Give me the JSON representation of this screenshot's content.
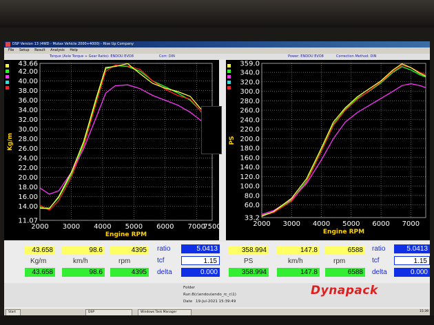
{
  "window": {
    "title": "DSP Version 13 (4WD - Mutax Vehicle 2000+4000) - Rise Up Company",
    "menu": [
      "File",
      "Setup",
      "Result",
      "Analysis",
      "Help"
    ]
  },
  "status": {
    "left": "Torque (Axle Torque ÷ Gear Ratio): ENDOU EVO8",
    "corr_left": "Corr: DIN",
    "right": "Power: ENDOU EVO8",
    "corr_right": "Correction Method: DIN"
  },
  "colors": {
    "green": "#22ff22",
    "red": "#ff2020",
    "magenta": "#ff33ff",
    "yellow": "#ffff44",
    "cyan": "#33dddd",
    "accent": "#ffd200"
  },
  "left_chart": {
    "ylabel": "Kg/m",
    "xlabel": "Engine RPM",
    "y_ticks": [
      "43.66",
      "42.00",
      "40.00",
      "38.00",
      "36.00",
      "34.00",
      "32.00",
      "30.00",
      "28.00",
      "26.00",
      "24.00",
      "22.00",
      "20.00",
      "18.00",
      "16.00",
      "14.00",
      "11.07"
    ],
    "x_ticks": [
      "2000",
      "3000",
      "4000",
      "5000",
      "6000",
      "7000",
      "7500"
    ]
  },
  "right_chart": {
    "ylabel": "PS",
    "xlabel": "Engine RPM",
    "y_ticks": [
      "359.0",
      "340.0",
      "320.0",
      "300.0",
      "280.0",
      "260.0",
      "240.0",
      "220.0",
      "200.0",
      "180.0",
      "160.0",
      "140.0",
      "120.0",
      "100.0",
      "80.0",
      "60.0",
      "33.2"
    ],
    "x_ticks": [
      "2000",
      "3000",
      "4000",
      "5000",
      "6000",
      "7000"
    ]
  },
  "chart_data": [
    {
      "type": "line",
      "xlabel": "Engine RPM",
      "ylabel": "Kg/m",
      "xlim": [
        2000,
        7500
      ],
      "ylim": [
        11.07,
        43.66
      ],
      "grid": true,
      "series": [
        {
          "color": "#22ff22",
          "x": [
            2000,
            2300,
            2600,
            3000,
            3400,
            3800,
            4100,
            4400,
            4800,
            5200,
            5600,
            6000,
            6400,
            6800,
            7100,
            7500
          ],
          "values": [
            13.8,
            13.6,
            15.8,
            20.5,
            27.0,
            36.0,
            42.5,
            43.2,
            43.0,
            42.0,
            40.0,
            38.8,
            37.5,
            36.0,
            34.0,
            30.5
          ]
        },
        {
          "color": "#ff2020",
          "x": [
            2000,
            2300,
            2600,
            3000,
            3400,
            3800,
            4100,
            4400,
            4800,
            5200,
            5600,
            6000,
            6400,
            6800,
            7100,
            7500
          ],
          "values": [
            14.2,
            13.2,
            15.2,
            20.0,
            26.5,
            35.5,
            42.0,
            43.3,
            43.1,
            42.4,
            40.0,
            38.3,
            37.0,
            36.2,
            34.0,
            31.0
          ]
        },
        {
          "color": "#ff33ff",
          "x": [
            2000,
            2300,
            2600,
            3000,
            3400,
            3800,
            4100,
            4400,
            4800,
            5200,
            5600,
            6000,
            6400,
            6800,
            7100,
            7500
          ],
          "values": [
            17.8,
            16.5,
            17.2,
            21.0,
            26.0,
            32.5,
            37.5,
            39.0,
            39.2,
            38.4,
            37.0,
            36.0,
            35.0,
            33.5,
            32.0,
            30.0
          ]
        },
        {
          "color": "#ffff44",
          "x": [
            2000,
            2300,
            2600,
            3000,
            3400,
            3800,
            4100,
            4400,
            4800,
            5200,
            5600,
            6000,
            6400,
            6800,
            7100,
            7500
          ],
          "values": [
            13.6,
            13.5,
            16.0,
            21.0,
            27.5,
            36.5,
            42.8,
            43.0,
            43.6,
            41.5,
            39.5,
            38.5,
            37.8,
            36.8,
            34.5,
            31.5
          ]
        }
      ]
    },
    {
      "type": "line",
      "xlabel": "Engine RPM",
      "ylabel": "PS",
      "xlim": [
        2000,
        7500
      ],
      "ylim": [
        33.2,
        359.0
      ],
      "grid": true,
      "series": [
        {
          "color": "#22ff22",
          "x": [
            2000,
            2400,
            3000,
            3500,
            4000,
            4400,
            4800,
            5200,
            5600,
            6000,
            6400,
            6700,
            7000,
            7300,
            7500
          ],
          "values": [
            38,
            45,
            70,
            110,
            175,
            230,
            262,
            285,
            300,
            318,
            340,
            352,
            345,
            335,
            330
          ]
        },
        {
          "color": "#ff2020",
          "x": [
            2000,
            2400,
            3000,
            3500,
            4000,
            4400,
            4800,
            5200,
            5600,
            6000,
            6400,
            6700,
            7000,
            7300,
            7500
          ],
          "values": [
            37,
            44,
            68,
            108,
            173,
            228,
            260,
            283,
            301,
            320,
            342,
            355,
            350,
            340,
            335
          ]
        },
        {
          "color": "#ff33ff",
          "x": [
            2000,
            2400,
            3000,
            3500,
            4000,
            4400,
            4800,
            5200,
            5600,
            6000,
            6400,
            6700,
            7000,
            7300,
            7500
          ],
          "values": [
            40,
            48,
            72,
            105,
            155,
            200,
            235,
            255,
            270,
            285,
            300,
            312,
            316,
            312,
            308
          ]
        },
        {
          "color": "#ffff44",
          "x": [
            2000,
            2400,
            3000,
            3500,
            4000,
            4400,
            4800,
            5200,
            5600,
            6000,
            6400,
            6700,
            7000,
            7300,
            7500
          ],
          "values": [
            36,
            46,
            74,
            115,
            180,
            235,
            265,
            288,
            305,
            322,
            345,
            358,
            350,
            338,
            332
          ]
        }
      ]
    }
  ],
  "readouts": {
    "torque_top": "43.658",
    "speed_top": "98.6",
    "rpm_top": "4395",
    "torque_unit": "Kg/m",
    "speed_unit": "km/h",
    "rpm_unit": "rpm",
    "torque_bot": "43.658",
    "speed_bot": "98.6",
    "rpm_bot": "4395",
    "ratio_label": "ratio",
    "ratio_left": "5.0413",
    "tcf_label": "tcf",
    "tcf_left": "1.15",
    "delta_label": "delta",
    "delta_left": "0.000",
    "power_top": "358.994",
    "pspeed_top": "147.8",
    "prpm_top": "6588",
    "power_unit": "PS",
    "pspeed_unit": "km/h",
    "prpm_unit": "rpm",
    "power_bot": "358.994",
    "pspeed_bot": "147.8",
    "prpm_bot": "6588",
    "ratio_right": "5.0413",
    "tcf_right": "1.15",
    "delta_right": "0.000"
  },
  "info": {
    "folder_label": "Folder",
    "run_label": "Run:8(c\\endou\\endo_rc_c\\1)",
    "date_label": "Date",
    "date_value": "19-Jul-2021 15:39:49"
  },
  "brand": "Dynapack",
  "taskbar": {
    "start": "Start",
    "items": [
      "DSP",
      "Windows Task Manager"
    ],
    "tray": "15:39"
  }
}
